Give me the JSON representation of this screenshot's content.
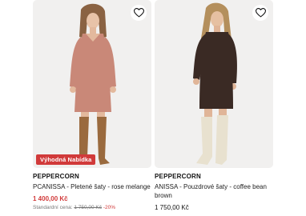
{
  "products": [
    {
      "brand": "PEPPERCORN",
      "title": "PCANISSA - Pletené šaty - rose melange",
      "badge": "Výhodná Nabídka",
      "price": "1 400,00 Kč",
      "standard_label": "Standardní cena:",
      "old_price": "1 750,00 Kč",
      "discount": "-20%",
      "dress_color": "#c98878"
    },
    {
      "brand": "PEPPERCORN",
      "title": "ANISSA - Pouzdrové šaty - coffee bean brown",
      "price": "1 750,00 Kč",
      "dress_color": "#3a2a24"
    }
  ],
  "icons": {
    "favorite": "heart-outline-icon"
  },
  "colors": {
    "sale": "#d13a3a",
    "photo_bg": "#f1f0ef"
  }
}
